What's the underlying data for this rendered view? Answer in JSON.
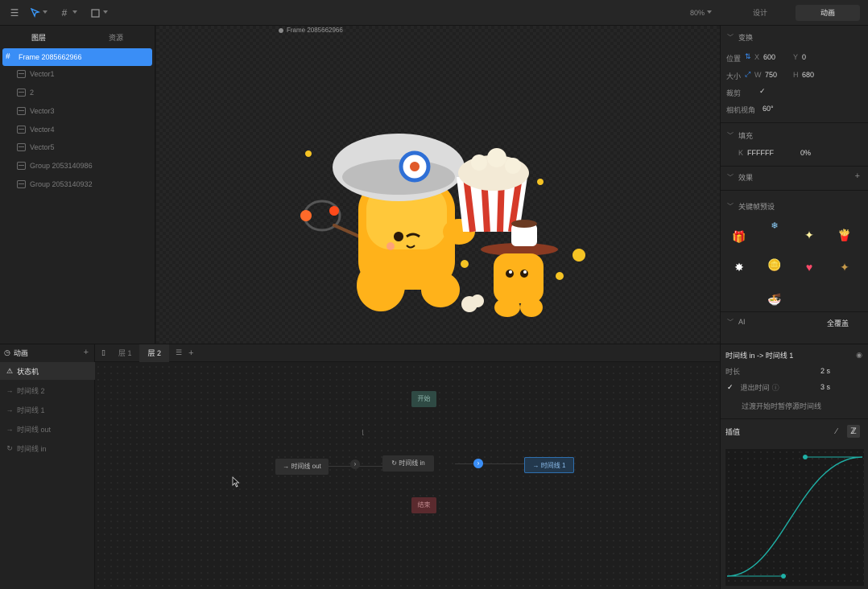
{
  "toolbar": {
    "menu_icon": "menu-icon",
    "select_tool_icon": "pointer-icon",
    "frame_tool_icon": "frame-icon",
    "shape_tool_icon": "shape-icon",
    "zoom": "80%",
    "tab_design": "设计",
    "tab_animation": "动画"
  },
  "layers_panel": {
    "tabs": [
      "图层",
      "资源"
    ],
    "items": [
      {
        "label": "Frame 2085662966",
        "selected": true
      },
      {
        "label": "Vector1"
      },
      {
        "label": "2"
      },
      {
        "label": "Vector3"
      },
      {
        "label": "Vector4"
      },
      {
        "label": "Vector5"
      },
      {
        "label": "Group 2053140986"
      },
      {
        "label": "Group 2053140932"
      }
    ]
  },
  "canvas": {
    "frame_label": "Frame 2085662966"
  },
  "properties": {
    "transform": {
      "title": "变换",
      "position_label": "位置",
      "x_label": "X",
      "x": "600",
      "y_label": "Y",
      "y": "0",
      "size_label": "大小",
      "w_label": "W",
      "w": "750",
      "h_label": "H",
      "h": "680",
      "clip_label": "裁剪",
      "clip_checked": true,
      "camera_label": "相机视角",
      "camera": "60°"
    },
    "fill": {
      "title": "填充",
      "color_hex": "FFFFFF",
      "opacity": "0%"
    },
    "effects": {
      "title": "效果"
    },
    "keyframe_presets": {
      "title": "关键帧预设",
      "stickers": [
        "gift-icon",
        "snowflake-icon",
        "sparkle-icon",
        "fries-icon",
        "burst-icon",
        "coin-icon",
        "heart-icon",
        "star-icon",
        "bowl-icon"
      ]
    },
    "ai": {
      "title": "AI",
      "mode": "全覆盖"
    }
  },
  "animation_panel": {
    "title": "动画",
    "items": [
      {
        "label": "状态机",
        "icon": "state-machine-icon",
        "active": true
      },
      {
        "label": "时间线 2",
        "icon": "arrow-right-icon"
      },
      {
        "label": "时间线 1",
        "icon": "arrow-right-icon"
      },
      {
        "label": "时间线 out",
        "icon": "arrow-right-icon"
      },
      {
        "label": "时间线 in",
        "icon": "loop-icon"
      }
    ]
  },
  "state_machine": {
    "layer_tabs": [
      "层 1",
      "层 2"
    ],
    "active_layer": "层 2",
    "nodes": {
      "start": "开始",
      "end": "结束",
      "timeline_out": "时间线 out",
      "timeline_in": "时间线 in",
      "timeline_1": "时间线 1"
    }
  },
  "transition": {
    "title": "时间线 in -> 时间线 1",
    "duration_label": "时长",
    "duration": "2 s",
    "exit_time_label": "退出时间",
    "exit_time_checked": true,
    "exit_time": "3 s",
    "option_label": "过渡开始时暂停源时间线",
    "interpolation_label": "插值"
  },
  "colors": {
    "accent": "#3a8ef6",
    "curve": "#1fb0a6",
    "start_node": "#2f4a44",
    "end_node": "#5a2a2e"
  }
}
